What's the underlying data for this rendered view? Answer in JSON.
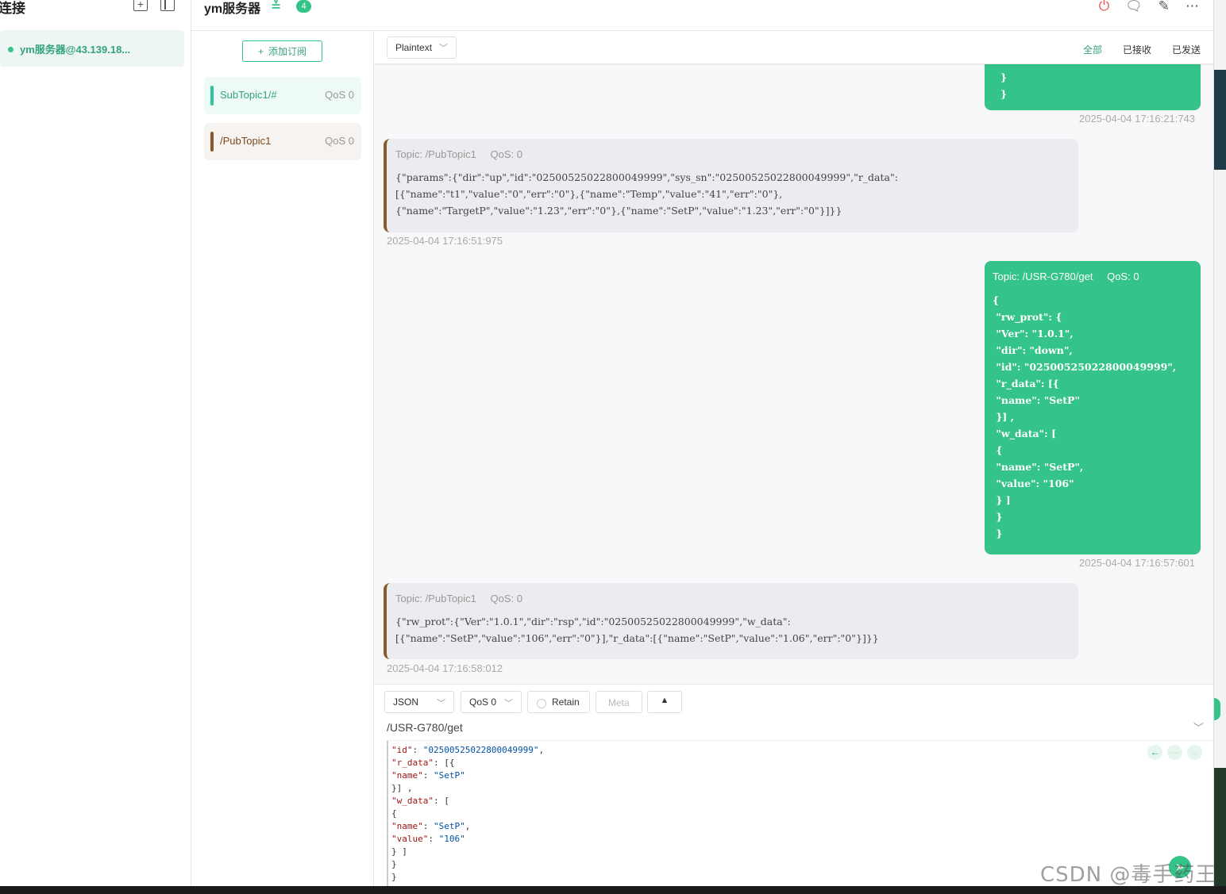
{
  "connections": {
    "title": "连接",
    "items": [
      {
        "name": "ym服务器@43.139.18...",
        "status_color": "#34c388"
      }
    ]
  },
  "header": {
    "title": "ym服务器",
    "badge": "4",
    "icons": [
      "power-icon",
      "chat-icon",
      "edit-icon",
      "more-icon"
    ]
  },
  "subscriptions": {
    "add_label": "添加订阅",
    "items": [
      {
        "topic": "SubTopic1/#",
        "qos": "QoS 0",
        "color": "#34c3a0",
        "bg": "#eefaf6",
        "text_color": "#34a37a"
      },
      {
        "topic": "/PubTopic1",
        "qos": "QoS 0",
        "color": "#8b5a2b",
        "bg": "#f7f3f0",
        "text_color": "#7a4a20"
      }
    ]
  },
  "toolbar": {
    "format": "Plaintext",
    "filters": [
      "全部",
      "已接收",
      "已发送"
    ]
  },
  "messages": {
    "m1": {
      "body": "}\n}",
      "time": "2025-04-04 17:16:21:743"
    },
    "m2": {
      "topic": "Topic: /PubTopic1",
      "qos": "QoS: 0",
      "body": "{\"params\":{\"dir\":\"up\",\"id\":\"02500525022800049999\",\"sys_sn\":\"02500525022800049999\",\"r_data\":\n[{\"name\":\"t1\",\"value\":\"0\",\"err\":\"0\"},{\"name\":\"Temp\",\"value\":\"41\",\"err\":\"0\"},\n{\"name\":\"TargetP\",\"value\":\"1.23\",\"err\":\"0\"},{\"name\":\"SetP\",\"value\":\"1.23\",\"err\":\"0\"}]}}",
      "time": "2025-04-04 17:16:51:975"
    },
    "m3": {
      "topic": "Topic: /USR-G780/get",
      "qos": "QoS: 0",
      "body": "{\n \"rw_prot\": {\n \"Ver\": \"1.0.1\",\n \"dir\": \"down\",\n \"id\": \"02500525022800049999\",\n \"r_data\": [{\n \"name\": \"SetP\"\n }] ,\n \"w_data\": [\n {\n \"name\": \"SetP\",\n \"value\": \"106\"\n } ]\n }\n }",
      "time": "2025-04-04 17:16:57:601"
    },
    "m4": {
      "topic": "Topic: /PubTopic1",
      "qos": "QoS: 0",
      "body": "{\"rw_prot\":{\"Ver\":\"1.0.1\",\"dir\":\"rsp\",\"id\":\"02500525022800049999\",\"w_data\":\n[{\"name\":\"SetP\",\"value\":\"106\",\"err\":\"0\"}],\"r_data\":[{\"name\":\"SetP\",\"value\":\"1.06\",\"err\":\"0\"}]}}",
      "time": "2025-04-04 17:16:58:012"
    }
  },
  "composer": {
    "format": "JSON",
    "qos": "QoS 0",
    "retain": "Retain",
    "meta": "Meta",
    "topic": "/USR-G780/get",
    "editor_lines": [
      "\"id\": \"02500525022800049999\",",
      "\"r_data\": [{",
      "\"name\": \"SetP\"",
      "}] ,",
      "\"w_data\": [",
      "{",
      "\"name\": \"SetP\",",
      "\"value\": \"106\"",
      "} ]",
      "}",
      "}"
    ]
  },
  "watermark": "CSDN @毒手药王",
  "colors": {
    "accent": "#34c388",
    "received_border": "#8b5a2b"
  }
}
